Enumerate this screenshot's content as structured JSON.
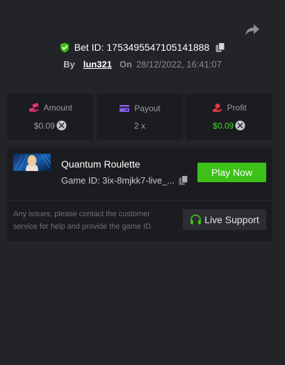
{
  "header": {
    "bet_id": "Bet ID: 1753495547105141888",
    "by_label": "By",
    "username": "lun321",
    "on_label": "On",
    "datetime": "28/12/2022, 16:41:07",
    "icons": [
      "share-icon",
      "shield-check-icon",
      "copy-icon"
    ]
  },
  "stats": {
    "amount": {
      "label": "Amount",
      "value": "$0.09"
    },
    "payout": {
      "label": "Payout",
      "value": "2 x"
    },
    "profit": {
      "label": "Profit",
      "value": "$0.09"
    }
  },
  "game": {
    "title": "Quantum Roulette",
    "game_id": "Game ID: 3ix-8mjkk7-live_...",
    "play_label": "Play Now"
  },
  "support": {
    "help_text": "Any issues, please contact the customer service for help and provide the game ID.",
    "button_label": "Live Support"
  },
  "colors": {
    "background": "#232428",
    "panel": "#1b1c1f",
    "accent_green": "#3bc117",
    "profit_green": "#3dd72e",
    "amount_pink": "#e8336f",
    "payout_purple": "#8c5cf4",
    "profit_red": "#e63946"
  }
}
